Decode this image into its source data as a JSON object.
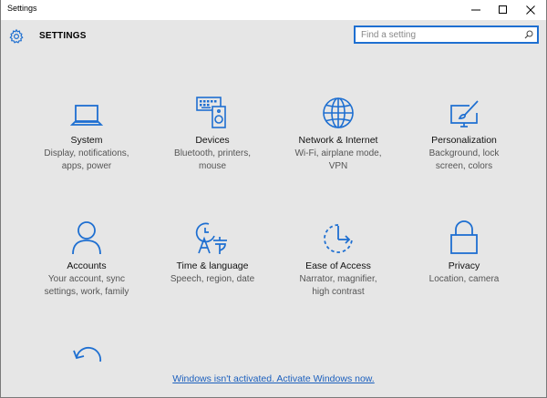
{
  "window": {
    "title": "Settings"
  },
  "header": {
    "title": "SETTINGS",
    "search_placeholder": "Find a setting"
  },
  "accent": "#1e6fd1",
  "tiles": [
    {
      "name": "System",
      "line1": "Display, notifications,",
      "line2": "apps, power",
      "icon": "laptop-icon"
    },
    {
      "name": "Devices",
      "line1": "Bluetooth, printers,",
      "line2": "mouse",
      "icon": "devices-icon"
    },
    {
      "name": "Network & Internet",
      "line1": "Wi-Fi, airplane mode,",
      "line2": "VPN",
      "icon": "globe-icon"
    },
    {
      "name": "Personalization",
      "line1": "Background, lock",
      "line2": "screen, colors",
      "icon": "paint-icon"
    },
    {
      "name": "Accounts",
      "line1": "Your account, sync",
      "line2": "settings, work, family",
      "icon": "person-icon"
    },
    {
      "name": "Time & language",
      "line1": "Speech, region, date",
      "line2": "",
      "icon": "time-language-icon"
    },
    {
      "name": "Ease of Access",
      "line1": "Narrator, magnifier,",
      "line2": "high contrast",
      "icon": "ease-of-access-icon"
    },
    {
      "name": "Privacy",
      "line1": "Location, camera",
      "line2": "",
      "icon": "lock-icon"
    }
  ],
  "activation_link": "Windows isn't activated. Activate Windows now."
}
